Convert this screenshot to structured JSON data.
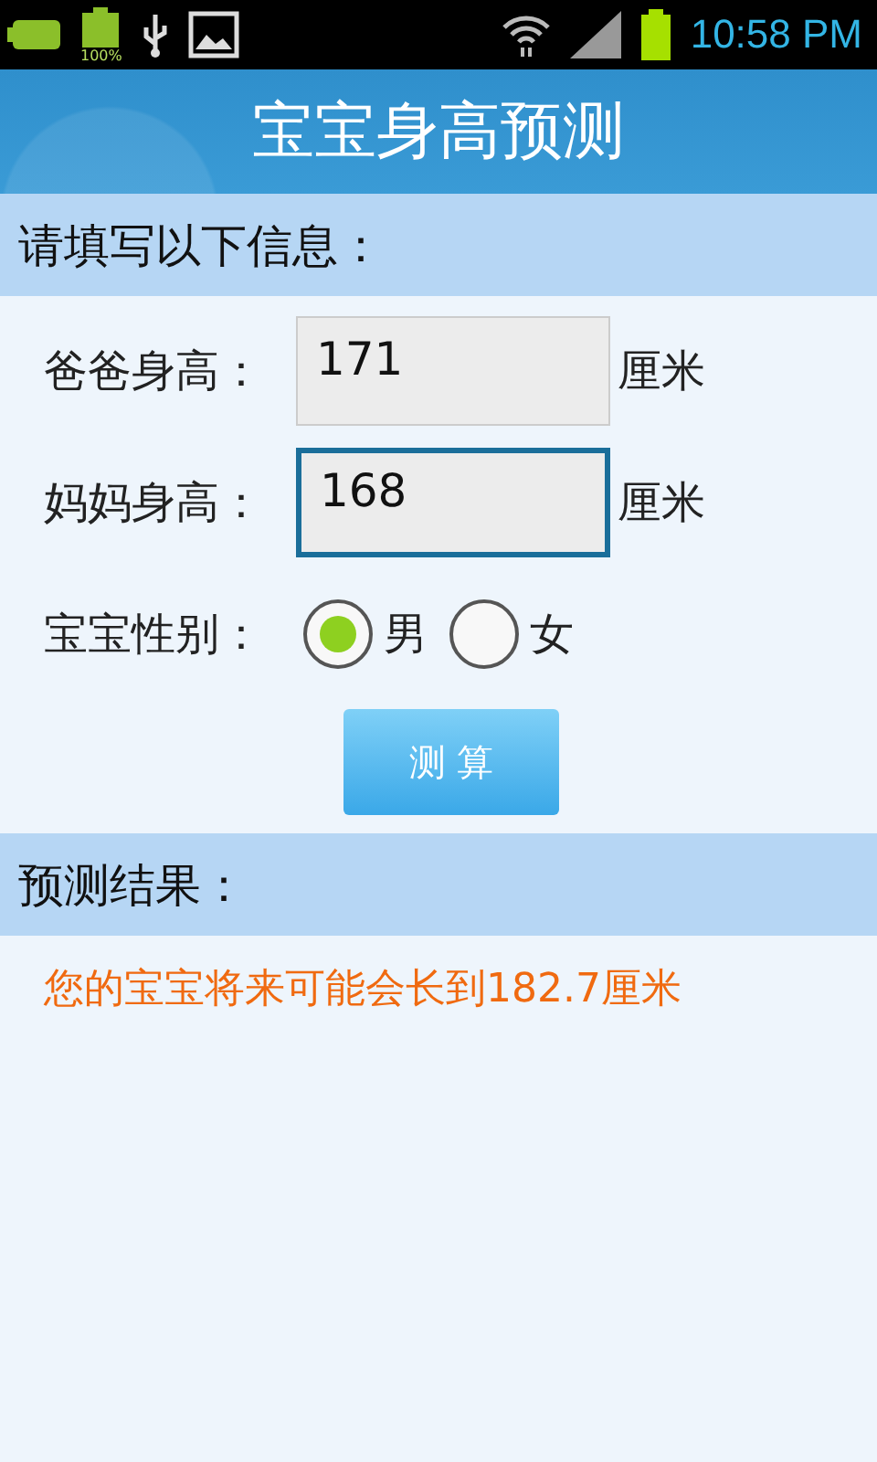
{
  "status_bar": {
    "battery_label": "100%",
    "time": "10:58 PM"
  },
  "title_bar": {
    "title": "宝宝身高预测"
  },
  "form": {
    "header": "请填写以下信息：",
    "fields": [
      {
        "label": "爸爸身高：",
        "value": "171",
        "unit": "厘米",
        "focused": false
      },
      {
        "label": "妈妈身高：",
        "value": "168",
        "unit": "厘米",
        "focused": true
      }
    ],
    "gender": {
      "label": "宝宝性别：",
      "options": [
        {
          "label": "男",
          "selected": true
        },
        {
          "label": "女",
          "selected": false
        }
      ]
    },
    "button": "测 算"
  },
  "result": {
    "header": "预测结果：",
    "text": "您的宝宝将来可能会长到182.7厘米"
  }
}
